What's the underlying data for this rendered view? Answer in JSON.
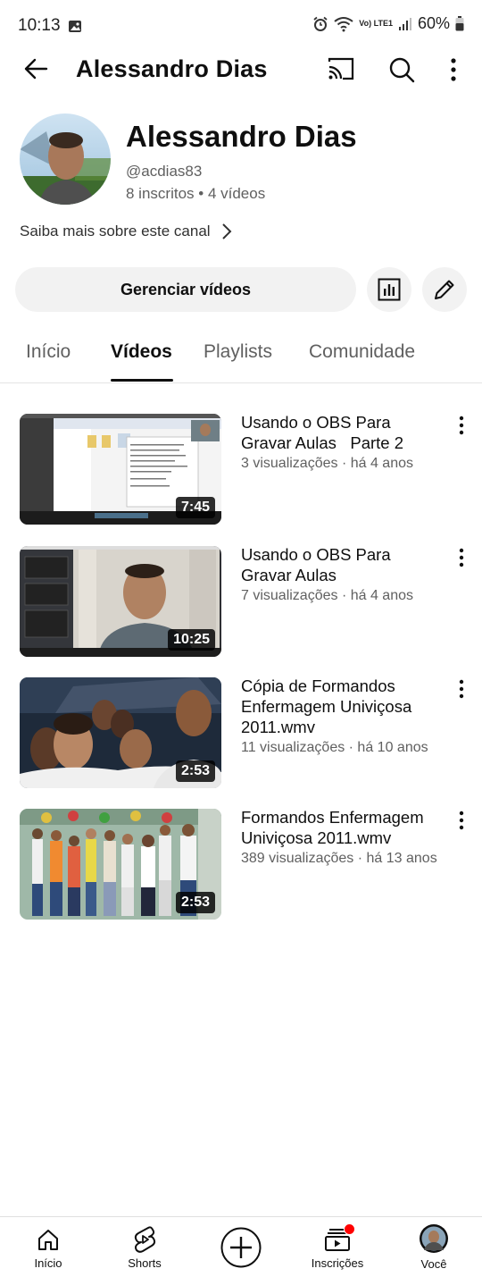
{
  "status_bar": {
    "time": "10:13",
    "battery": "60%",
    "network": "Vo) LTE1"
  },
  "header": {
    "title": "Alessandro Dias"
  },
  "channel": {
    "name": "Alessandro Dias",
    "handle": "@acdias83",
    "subscribers": "8 inscritos",
    "separator": " • ",
    "videos": "4 vídeos",
    "about_link": "Saiba mais sobre este canal"
  },
  "actions": {
    "manage_videos": "Gerenciar vídeos"
  },
  "tabs": [
    {
      "label": "Início",
      "active": false
    },
    {
      "label": "Vídeos",
      "active": true
    },
    {
      "label": "Playlists",
      "active": false
    },
    {
      "label": "Comunidade",
      "active": false
    }
  ],
  "videos": [
    {
      "title_line1": "Usando o OBS Para",
      "title_line2": "Gravar Aulas   Parte 2",
      "title_line3": "",
      "meta": "3 visualizações · há 4 anos",
      "duration": "7:45"
    },
    {
      "title_line1": "Usando o OBS Para",
      "title_line2": "Gravar Aulas",
      "title_line3": "",
      "meta": "7 visualizações · há 4 anos",
      "duration": "10:25"
    },
    {
      "title_line1": "Cópia de Formandos",
      "title_line2": "Enfermagem Univiçosa",
      "title_line3": "2011.wmv",
      "meta": "11 visualizações · há 10 anos",
      "duration": "2:53"
    },
    {
      "title_line1": "Formandos Enfermagem",
      "title_line2": "Univiçosa 2011.wmv",
      "title_line3": "",
      "meta": "389 visualizações · há 13 anos",
      "duration": "2:53"
    }
  ],
  "bottom_nav": [
    {
      "label": "Início",
      "icon": "home-icon"
    },
    {
      "label": "Shorts",
      "icon": "shorts-icon"
    },
    {
      "label": "",
      "icon": "create-icon"
    },
    {
      "label": "Inscrições",
      "icon": "subscriptions-icon"
    },
    {
      "label": "Você",
      "icon": "you-avatar"
    }
  ],
  "colors": {
    "text": "#0f0f0f",
    "secondary": "#606060",
    "button_bg": "#f2f2f2",
    "notification": "#ff0000"
  }
}
